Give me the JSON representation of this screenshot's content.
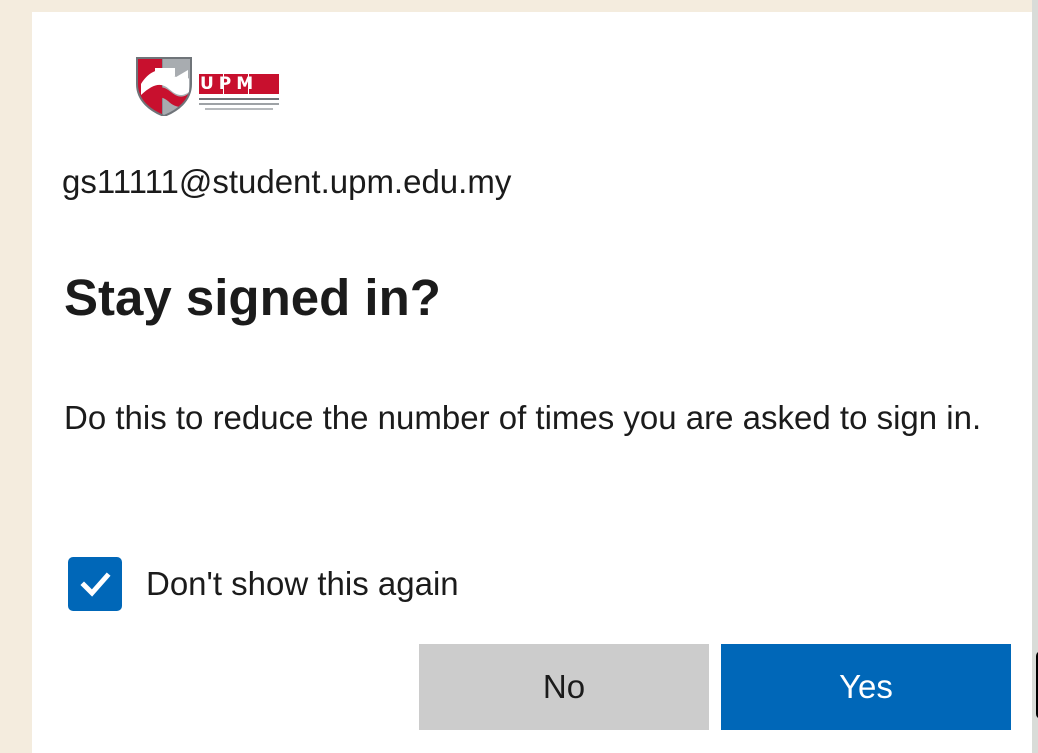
{
  "logo": {
    "text": "UPM",
    "icon": "upm-logo-icon",
    "colors": {
      "red": "#c8102e",
      "gray": "#8a8f94"
    }
  },
  "account": {
    "email": "gs11111@student.upm.edu.my"
  },
  "dialog": {
    "title": "Stay signed in?",
    "description": "Do this to reduce the number of times you are asked to sign in.",
    "checkbox": {
      "label": "Don't show this again",
      "checked": true
    },
    "buttons": {
      "no": "No",
      "yes": "Yes"
    }
  },
  "colors": {
    "primary": "#0067b8",
    "secondary_button": "#cccccc",
    "background": "#f4ecde",
    "text": "#1b1b1b"
  }
}
